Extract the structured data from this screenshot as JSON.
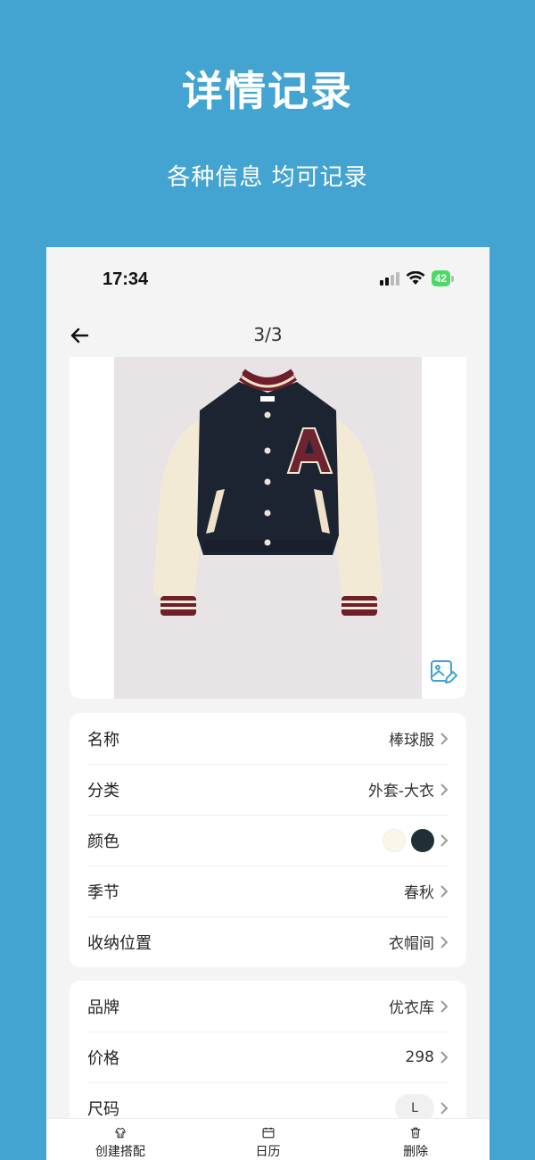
{
  "promo": {
    "title": "详情记录",
    "subtitle": "各种信息 均可记录"
  },
  "status_bar": {
    "time": "17:34",
    "battery": "42"
  },
  "nav": {
    "counter": "3/3",
    "back_icon": "arrow-left-icon"
  },
  "image": {
    "description_icon": "image-edit-icon"
  },
  "details": [
    {
      "label": "名称",
      "value": "棒球服"
    },
    {
      "label": "分类",
      "value": "外套-大衣"
    },
    {
      "label": "颜色",
      "colors": [
        "#fbf6ea",
        "#1f2f33"
      ]
    },
    {
      "label": "季节",
      "value": "春秋"
    },
    {
      "label": "收纳位置",
      "value": "衣帽间"
    }
  ],
  "extra": [
    {
      "label": "品牌",
      "value": "优衣库"
    },
    {
      "label": "价格",
      "value": "298"
    },
    {
      "label": "尺码",
      "value": "L"
    }
  ],
  "tabs": [
    {
      "label": "创建搭配",
      "icon": "outfit-icon"
    },
    {
      "label": "日历",
      "icon": "calendar-icon"
    },
    {
      "label": "删除",
      "icon": "trash-icon"
    }
  ]
}
